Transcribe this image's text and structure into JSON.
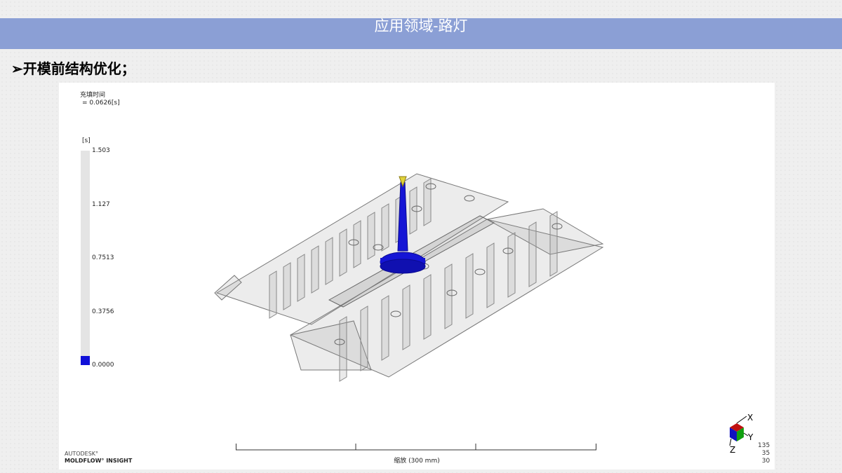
{
  "header": {
    "title": "应用领域-路灯"
  },
  "section": {
    "heading": "➢开模前结构优化；"
  },
  "viewer": {
    "result_name": "充填时间",
    "result_value": "= 0.0626[s]",
    "unit": "[s]",
    "legend_ticks": [
      "1.503",
      "1.127",
      "0.7513",
      "0.3756",
      "0.0000"
    ],
    "legend_colors": {
      "top": "#e4e4e4",
      "bottom": "#1010d8"
    },
    "brand_line1": "AUTODESK°",
    "brand_line2": "MOLDFLOW° INSIGHT",
    "scale_label": "缩放 (300 mm)",
    "axis_x": "X",
    "axis_y": "Y",
    "axis_z": "Z",
    "view_angles": [
      "135",
      "35",
      "30"
    ]
  }
}
